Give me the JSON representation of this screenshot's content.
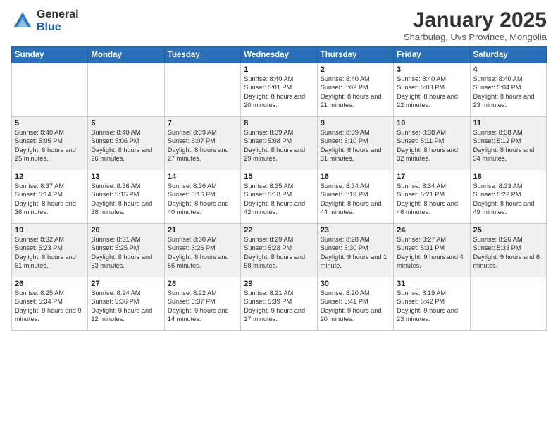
{
  "logo": {
    "general": "General",
    "blue": "Blue"
  },
  "header": {
    "month": "January 2025",
    "location": "Sharbulag, Uvs Province, Mongolia"
  },
  "days_of_week": [
    "Sunday",
    "Monday",
    "Tuesday",
    "Wednesday",
    "Thursday",
    "Friday",
    "Saturday"
  ],
  "weeks": [
    [
      {
        "day": "",
        "sunrise": "",
        "sunset": "",
        "daylight": ""
      },
      {
        "day": "",
        "sunrise": "",
        "sunset": "",
        "daylight": ""
      },
      {
        "day": "",
        "sunrise": "",
        "sunset": "",
        "daylight": ""
      },
      {
        "day": "1",
        "sunrise": "Sunrise: 8:40 AM",
        "sunset": "Sunset: 5:01 PM",
        "daylight": "Daylight: 8 hours and 20 minutes."
      },
      {
        "day": "2",
        "sunrise": "Sunrise: 8:40 AM",
        "sunset": "Sunset: 5:02 PM",
        "daylight": "Daylight: 8 hours and 21 minutes."
      },
      {
        "day": "3",
        "sunrise": "Sunrise: 8:40 AM",
        "sunset": "Sunset: 5:03 PM",
        "daylight": "Daylight: 8 hours and 22 minutes."
      },
      {
        "day": "4",
        "sunrise": "Sunrise: 8:40 AM",
        "sunset": "Sunset: 5:04 PM",
        "daylight": "Daylight: 8 hours and 23 minutes."
      }
    ],
    [
      {
        "day": "5",
        "sunrise": "Sunrise: 8:40 AM",
        "sunset": "Sunset: 5:05 PM",
        "daylight": "Daylight: 8 hours and 25 minutes."
      },
      {
        "day": "6",
        "sunrise": "Sunrise: 8:40 AM",
        "sunset": "Sunset: 5:06 PM",
        "daylight": "Daylight: 8 hours and 26 minutes."
      },
      {
        "day": "7",
        "sunrise": "Sunrise: 8:39 AM",
        "sunset": "Sunset: 5:07 PM",
        "daylight": "Daylight: 8 hours and 27 minutes."
      },
      {
        "day": "8",
        "sunrise": "Sunrise: 8:39 AM",
        "sunset": "Sunset: 5:08 PM",
        "daylight": "Daylight: 8 hours and 29 minutes."
      },
      {
        "day": "9",
        "sunrise": "Sunrise: 8:39 AM",
        "sunset": "Sunset: 5:10 PM",
        "daylight": "Daylight: 8 hours and 31 minutes."
      },
      {
        "day": "10",
        "sunrise": "Sunrise: 8:38 AM",
        "sunset": "Sunset: 5:11 PM",
        "daylight": "Daylight: 8 hours and 32 minutes."
      },
      {
        "day": "11",
        "sunrise": "Sunrise: 8:38 AM",
        "sunset": "Sunset: 5:12 PM",
        "daylight": "Daylight: 8 hours and 34 minutes."
      }
    ],
    [
      {
        "day": "12",
        "sunrise": "Sunrise: 8:37 AM",
        "sunset": "Sunset: 5:14 PM",
        "daylight": "Daylight: 8 hours and 36 minutes."
      },
      {
        "day": "13",
        "sunrise": "Sunrise: 8:36 AM",
        "sunset": "Sunset: 5:15 PM",
        "daylight": "Daylight: 8 hours and 38 minutes."
      },
      {
        "day": "14",
        "sunrise": "Sunrise: 8:36 AM",
        "sunset": "Sunset: 5:16 PM",
        "daylight": "Daylight: 8 hours and 40 minutes."
      },
      {
        "day": "15",
        "sunrise": "Sunrise: 8:35 AM",
        "sunset": "Sunset: 5:18 PM",
        "daylight": "Daylight: 8 hours and 42 minutes."
      },
      {
        "day": "16",
        "sunrise": "Sunrise: 8:34 AM",
        "sunset": "Sunset: 5:19 PM",
        "daylight": "Daylight: 8 hours and 44 minutes."
      },
      {
        "day": "17",
        "sunrise": "Sunrise: 8:34 AM",
        "sunset": "Sunset: 5:21 PM",
        "daylight": "Daylight: 8 hours and 46 minutes."
      },
      {
        "day": "18",
        "sunrise": "Sunrise: 8:33 AM",
        "sunset": "Sunset: 5:22 PM",
        "daylight": "Daylight: 8 hours and 49 minutes."
      }
    ],
    [
      {
        "day": "19",
        "sunrise": "Sunrise: 8:32 AM",
        "sunset": "Sunset: 5:23 PM",
        "daylight": "Daylight: 8 hours and 51 minutes."
      },
      {
        "day": "20",
        "sunrise": "Sunrise: 8:31 AM",
        "sunset": "Sunset: 5:25 PM",
        "daylight": "Daylight: 8 hours and 53 minutes."
      },
      {
        "day": "21",
        "sunrise": "Sunrise: 8:30 AM",
        "sunset": "Sunset: 5:26 PM",
        "daylight": "Daylight: 8 hours and 56 minutes."
      },
      {
        "day": "22",
        "sunrise": "Sunrise: 8:29 AM",
        "sunset": "Sunset: 5:28 PM",
        "daylight": "Daylight: 8 hours and 58 minutes."
      },
      {
        "day": "23",
        "sunrise": "Sunrise: 8:28 AM",
        "sunset": "Sunset: 5:30 PM",
        "daylight": "Daylight: 9 hours and 1 minute."
      },
      {
        "day": "24",
        "sunrise": "Sunrise: 8:27 AM",
        "sunset": "Sunset: 5:31 PM",
        "daylight": "Daylight: 9 hours and 4 minutes."
      },
      {
        "day": "25",
        "sunrise": "Sunrise: 8:26 AM",
        "sunset": "Sunset: 5:33 PM",
        "daylight": "Daylight: 9 hours and 6 minutes."
      }
    ],
    [
      {
        "day": "26",
        "sunrise": "Sunrise: 8:25 AM",
        "sunset": "Sunset: 5:34 PM",
        "daylight": "Daylight: 9 hours and 9 minutes."
      },
      {
        "day": "27",
        "sunrise": "Sunrise: 8:24 AM",
        "sunset": "Sunset: 5:36 PM",
        "daylight": "Daylight: 9 hours and 12 minutes."
      },
      {
        "day": "28",
        "sunrise": "Sunrise: 8:22 AM",
        "sunset": "Sunset: 5:37 PM",
        "daylight": "Daylight: 9 hours and 14 minutes."
      },
      {
        "day": "29",
        "sunrise": "Sunrise: 8:21 AM",
        "sunset": "Sunset: 5:39 PM",
        "daylight": "Daylight: 9 hours and 17 minutes."
      },
      {
        "day": "30",
        "sunrise": "Sunrise: 8:20 AM",
        "sunset": "Sunset: 5:41 PM",
        "daylight": "Daylight: 9 hours and 20 minutes."
      },
      {
        "day": "31",
        "sunrise": "Sunrise: 8:19 AM",
        "sunset": "Sunset: 5:42 PM",
        "daylight": "Daylight: 9 hours and 23 minutes."
      },
      {
        "day": "",
        "sunrise": "",
        "sunset": "",
        "daylight": ""
      }
    ]
  ]
}
